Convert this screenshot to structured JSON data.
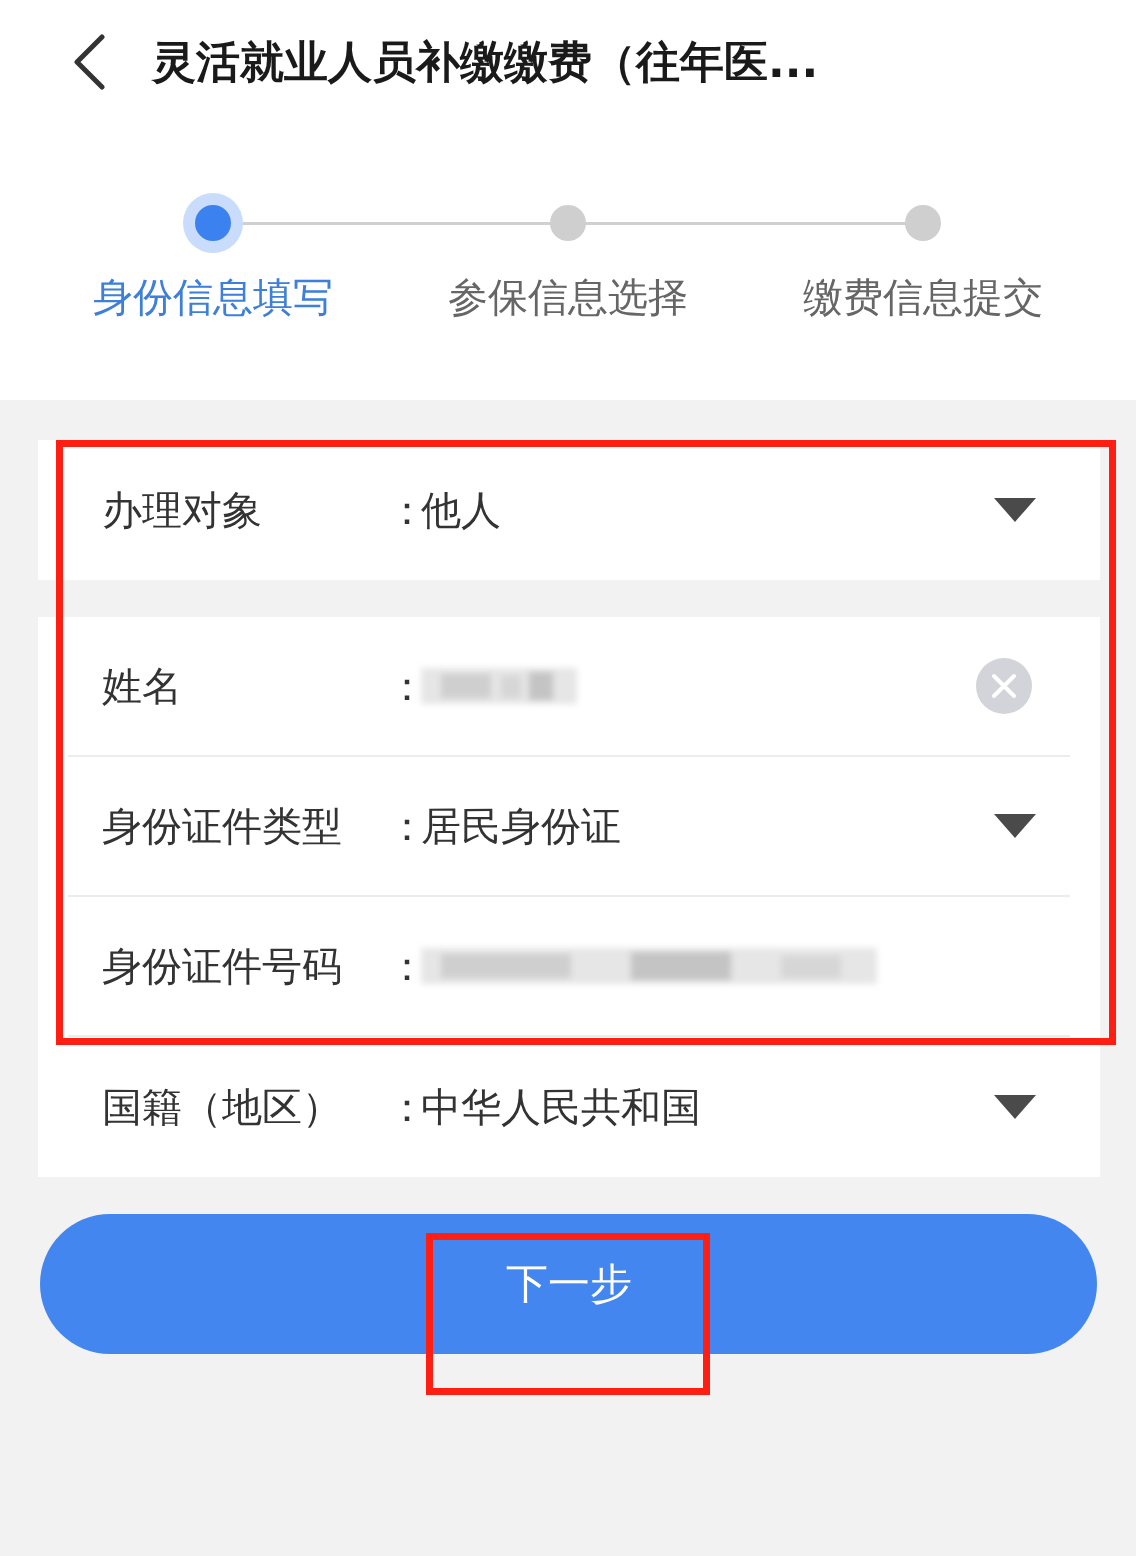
{
  "header": {
    "title": "灵活就业人员补缴缴费（往年医..."
  },
  "steps": [
    {
      "label": "身份信息填写",
      "selected": true
    },
    {
      "label": "参保信息选择",
      "selected": false
    },
    {
      "label": "缴费信息提交",
      "selected": false
    }
  ],
  "sections": [
    {
      "rows": [
        {
          "kind": "select",
          "label": "办理对象",
          "colon": "：",
          "value": "他人"
        }
      ]
    },
    {
      "rows": [
        {
          "kind": "redacted_clearable",
          "label": "姓名",
          "colon": "："
        },
        {
          "kind": "select",
          "label": "身份证件类型",
          "colon": "：",
          "value": "居民身份证"
        },
        {
          "kind": "redacted",
          "label": "身份证件号码",
          "colon": "："
        },
        {
          "kind": "select",
          "label": "国籍（地区）",
          "colon": "：",
          "value": "中华人民共和国"
        }
      ]
    }
  ],
  "button": {
    "label": "下一步"
  }
}
